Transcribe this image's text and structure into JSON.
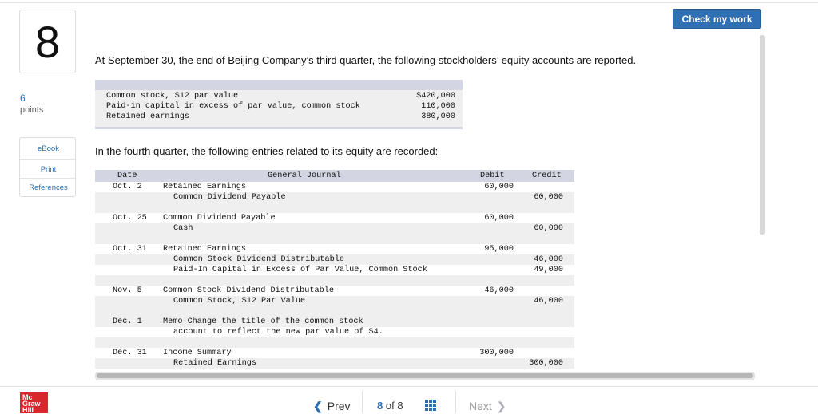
{
  "header": {
    "check_label": "Check my work"
  },
  "question": {
    "number": "8",
    "points_value": "6",
    "points_label": "points"
  },
  "sidebar": {
    "items": [
      {
        "label": "eBook"
      },
      {
        "label": "Print"
      },
      {
        "label": "References"
      }
    ]
  },
  "prompt": {
    "intro": "At September 30, the end of Beijing Company’s third quarter, the following stockholders’ equity accounts are reported.",
    "second": "In the fourth quarter, the following entries related to its equity are recorded:"
  },
  "equity_accounts": [
    {
      "label": "Common stock, $12 par value",
      "amount": "$420,000"
    },
    {
      "label": "Paid-in capital in excess of par value, common stock",
      "amount": "110,000"
    },
    {
      "label": "Retained earnings",
      "amount": "380,000"
    }
  ],
  "journal": {
    "headers": {
      "date": "Date",
      "title": "General Journal",
      "debit": "Debit",
      "credit": "Credit"
    },
    "lines": [
      {
        "date": "Oct. 2",
        "text": "Retained Earnings",
        "indent": false,
        "debit": "60,000",
        "credit": ""
      },
      {
        "date": "",
        "text": "Common Dividend Payable",
        "indent": true,
        "debit": "",
        "credit": "60,000"
      },
      {
        "date": "Oct. 25",
        "text": "Common Dividend Payable",
        "indent": false,
        "debit": "60,000",
        "credit": ""
      },
      {
        "date": "",
        "text": "Cash",
        "indent": true,
        "debit": "",
        "credit": "60,000"
      },
      {
        "date": "Oct. 31",
        "text": "Retained Earnings",
        "indent": false,
        "debit": "95,000",
        "credit": ""
      },
      {
        "date": "",
        "text": "Common Stock Dividend Distributable",
        "indent": true,
        "debit": "",
        "credit": "46,000"
      },
      {
        "date": "",
        "text": "Paid-In Capital in Excess of Par Value, Common Stock",
        "indent": true,
        "debit": "",
        "credit": "49,000"
      },
      {
        "date": "Nov. 5",
        "text": "Common Stock Dividend Distributable",
        "indent": false,
        "debit": "46,000",
        "credit": ""
      },
      {
        "date": "",
        "text": "Common Stock, $12 Par Value",
        "indent": true,
        "debit": "",
        "credit": "46,000"
      },
      {
        "date": "Dec. 1",
        "text": "Memo—Change the title of the common stock",
        "indent": false,
        "debit": "",
        "credit": ""
      },
      {
        "date": "",
        "text": "account to reflect the new par value of $4.",
        "indent": true,
        "debit": "",
        "credit": ""
      },
      {
        "date": "Dec. 31",
        "text": "Income Summary",
        "indent": false,
        "debit": "300,000",
        "credit": ""
      },
      {
        "date": "",
        "text": "Retained Earnings",
        "indent": true,
        "debit": "",
        "credit": "300,000"
      }
    ]
  },
  "footer": {
    "logo": "Mc Graw Hill",
    "prev_label": "Prev",
    "current_page": "8",
    "of_label": "of",
    "total_pages": "8",
    "next_label": "Next"
  },
  "colors": {
    "accent": "#2f6fb4",
    "table_header": "#d3d6e2",
    "stripe": "#efefef",
    "logo_red": "#d8262d"
  }
}
